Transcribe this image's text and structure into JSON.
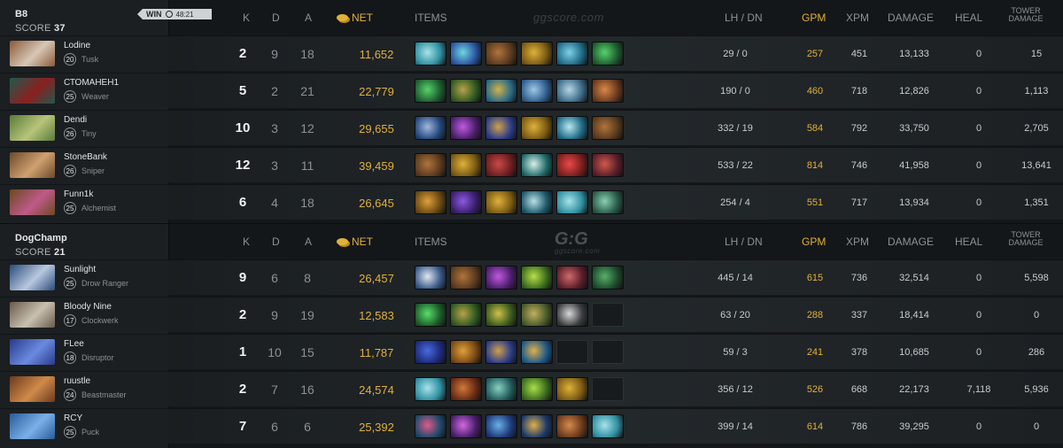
{
  "columns": {
    "k": "K",
    "d": "D",
    "a": "A",
    "net": "NET",
    "items": "ITEMS",
    "lh_dn": "LH  /  DN",
    "gpm": "GPM",
    "xpm": "XPM",
    "damage": "DAMAGE",
    "heal": "HEAL",
    "tower": "TOWER DAMAGE"
  },
  "watermark": {
    "text": "ggscore.com",
    "logo": "G:G",
    "logo_sub": "ggscore.com"
  },
  "teams": [
    {
      "name": "B8",
      "score_label": "SCORE",
      "score": "37",
      "badge": {
        "label": "WIN",
        "time": "48:21"
      },
      "players": [
        {
          "name": "Lodine",
          "level": "20",
          "hero": "Tusk",
          "k": "2",
          "d": "9",
          "a": "18",
          "net": "11,652",
          "lh_dn": "29  /  0",
          "gpm": "257",
          "xpm": "451",
          "damage": "13,133",
          "heal": "0",
          "tower": "15",
          "portrait": [
            "#8a5a3a",
            "#d8c7b5"
          ],
          "items": [
            [
              "#2f8fa0",
              "#a9e3ea"
            ],
            [
              "#2b55a3",
              "#6fd6e0"
            ],
            [
              "#5a3a1e",
              "#b0743c"
            ],
            [
              "#7a5a14",
              "#e0b13a"
            ],
            [
              "#1f6a86",
              "#7fd0e8"
            ],
            [
              "#1e5c30",
              "#58d36b"
            ]
          ]
        },
        {
          "name": "СТОМАНЕН1",
          "level": "25",
          "hero": "Weaver",
          "k": "5",
          "d": "2",
          "a": "21",
          "net": "22,779",
          "lh_dn": "190  /  0",
          "gpm": "460",
          "xpm": "718",
          "damage": "12,826",
          "heal": "0",
          "tower": "1,113",
          "portrait": [
            "#1f5a4f",
            "#8b1f1f"
          ],
          "items": [
            [
              "#1e5c30",
              "#58d36b"
            ],
            [
              "#2f5a22",
              "#b8a24a"
            ],
            [
              "#2a6a86",
              "#d2b24a"
            ],
            [
              "#2f5e8e",
              "#9fc8e8"
            ],
            [
              "#3d6a86",
              "#b5d6e6"
            ],
            [
              "#6a3a1e",
              "#d78a4a"
            ]
          ]
        },
        {
          "name": "Dendi",
          "level": "26",
          "hero": "Tiny",
          "k": "10",
          "d": "3",
          "a": "12",
          "net": "29,655",
          "lh_dn": "332  /  19",
          "gpm": "584",
          "xpm": "792",
          "damage": "33,750",
          "heal": "0",
          "tower": "2,705",
          "portrait": [
            "#5a7a3a",
            "#b8c47a"
          ],
          "items": [
            [
              "#23467a",
              "#9fb8e0"
            ],
            [
              "#4a1e6a",
              "#c05ae0"
            ],
            [
              "#2a3c8a",
              "#d0a04a"
            ],
            [
              "#7a5a14",
              "#e0b13a"
            ],
            [
              "#1f6a86",
              "#b8e8f0"
            ],
            [
              "#5a3a1e",
              "#b0743c"
            ]
          ]
        },
        {
          "name": "StoneBank",
          "level": "26",
          "hero": "Sniper",
          "k": "12",
          "d": "3",
          "a": "11",
          "net": "39,459",
          "lh_dn": "533  /  22",
          "gpm": "814",
          "xpm": "746",
          "damage": "41,958",
          "heal": "0",
          "tower": "13,641",
          "portrait": [
            "#6a4a2a",
            "#d0a070"
          ],
          "items": [
            [
              "#5a3a1e",
              "#b0743c"
            ],
            [
              "#7a5a14",
              "#e0b13a"
            ],
            [
              "#6a1e1e",
              "#c84a4a"
            ],
            [
              "#1f6a6a",
              "#d8f0e8"
            ],
            [
              "#7a1e1e",
              "#e84a4a"
            ],
            [
              "#5a1e2a",
              "#d05a4a"
            ]
          ]
        },
        {
          "name": "Funn1k",
          "level": "25",
          "hero": "Alchemist",
          "k": "6",
          "d": "4",
          "a": "18",
          "net": "26,645",
          "lh_dn": "254  /  4",
          "gpm": "551",
          "xpm": "717",
          "damage": "13,934",
          "heal": "0",
          "tower": "1,351",
          "portrait": [
            "#6a4a1e",
            "#c05a8a"
          ],
          "items": [
            [
              "#6a4a14",
              "#e0a03a"
            ],
            [
              "#3a1e6a",
              "#8a5ae0"
            ],
            [
              "#7a5a14",
              "#e0b13a"
            ],
            [
              "#1f5a6a",
              "#b8e0e8"
            ],
            [
              "#2f8fa0",
              "#a9e3ea"
            ],
            [
              "#2a5a4a",
              "#8ad0b0"
            ]
          ]
        }
      ]
    },
    {
      "name": "DogChamp",
      "score_label": "SCORE",
      "score": "21",
      "players": [
        {
          "name": "Sunlight",
          "level": "25",
          "hero": "Drow Ranger",
          "k": "9",
          "d": "6",
          "a": "8",
          "net": "26,457",
          "lh_dn": "445  /  14",
          "gpm": "615",
          "xpm": "736",
          "damage": "32,514",
          "heal": "0",
          "tower": "5,598",
          "portrait": [
            "#2a4a7a",
            "#b8c8e0"
          ],
          "items": [
            [
              "#3a5a8a",
              "#e0e8f0"
            ],
            [
              "#5a3a1e",
              "#b0743c"
            ],
            [
              "#4a1e6a",
              "#c05ae0"
            ],
            [
              "#3a6a1e",
              "#b8e04a"
            ],
            [
              "#5a1e2a",
              "#d06a6a"
            ],
            [
              "#1e4a2a",
              "#58b06b"
            ]
          ]
        },
        {
          "name": "Bloody Nine",
          "level": "17",
          "hero": "Clockwerk",
          "k": "2",
          "d": "9",
          "a": "19",
          "net": "12,583",
          "lh_dn": "63  /  20",
          "gpm": "288",
          "xpm": "337",
          "damage": "18,414",
          "heal": "0",
          "tower": "0",
          "portrait": [
            "#6a5a4a",
            "#c8c0b0"
          ],
          "items": [
            [
              "#1e5a2a",
              "#58e06b"
            ],
            [
              "#2f5a22",
              "#b8a24a"
            ],
            [
              "#3a5a1e",
              "#d0c04a"
            ],
            [
              "#4a5a2a",
              "#c0b060"
            ],
            [
              "#3a3c3e",
              "#d8d8d8"
            ],
            null
          ]
        },
        {
          "name": "FLee",
          "level": "18",
          "hero": "Disruptor",
          "k": "1",
          "d": "10",
          "a": "15",
          "net": "11,787",
          "lh_dn": "59  /  3",
          "gpm": "241",
          "xpm": "378",
          "damage": "10,685",
          "heal": "0",
          "tower": "286",
          "portrait": [
            "#2a3a8a",
            "#6a8ae0"
          ],
          "items": [
            [
              "#1e2a7a",
              "#4a6ae0"
            ],
            [
              "#7a4a14",
              "#e0a03a"
            ],
            [
              "#2a3c8a",
              "#d0a04a"
            ],
            [
              "#1e5a8a",
              "#e0b04a"
            ],
            null,
            null
          ]
        },
        {
          "name": "ruustle",
          "level": "24",
          "hero": "Beastmaster",
          "k": "2",
          "d": "7",
          "a": "16",
          "net": "24,574",
          "lh_dn": "356  /  12",
          "gpm": "526",
          "xpm": "668",
          "damage": "22,173",
          "heal": "7,118",
          "tower": "5,936",
          "portrait": [
            "#6a3a1e",
            "#d08a4a"
          ],
          "items": [
            [
              "#2f8fa0",
              "#a9e3ea"
            ],
            [
              "#6a2a14",
              "#d07a3a"
            ],
            [
              "#1f5a5a",
              "#8ad0c0"
            ],
            [
              "#3a6a1e",
              "#a8e04a"
            ],
            [
              "#7a5a14",
              "#e0b13a"
            ],
            null
          ]
        },
        {
          "name": "RCY",
          "level": "25",
          "hero": "Puck",
          "k": "7",
          "d": "6",
          "a": "6",
          "net": "25,392",
          "lh_dn": "399  /  14",
          "gpm": "614",
          "xpm": "786",
          "damage": "39,295",
          "heal": "0",
          "tower": "0",
          "portrait": [
            "#2a5a9a",
            "#7ab0e8"
          ],
          "items": [
            [
              "#1e4a6a",
              "#e05a8a"
            ],
            [
              "#4a1e6a",
              "#d06ae0"
            ],
            [
              "#1e3a7a",
              "#6ab0e8"
            ],
            [
              "#1e3a6a",
              "#e0b04a"
            ],
            [
              "#6a3a1e",
              "#d78a4a"
            ],
            [
              "#2f8fa0",
              "#a9e3ea"
            ]
          ]
        }
      ]
    }
  ]
}
